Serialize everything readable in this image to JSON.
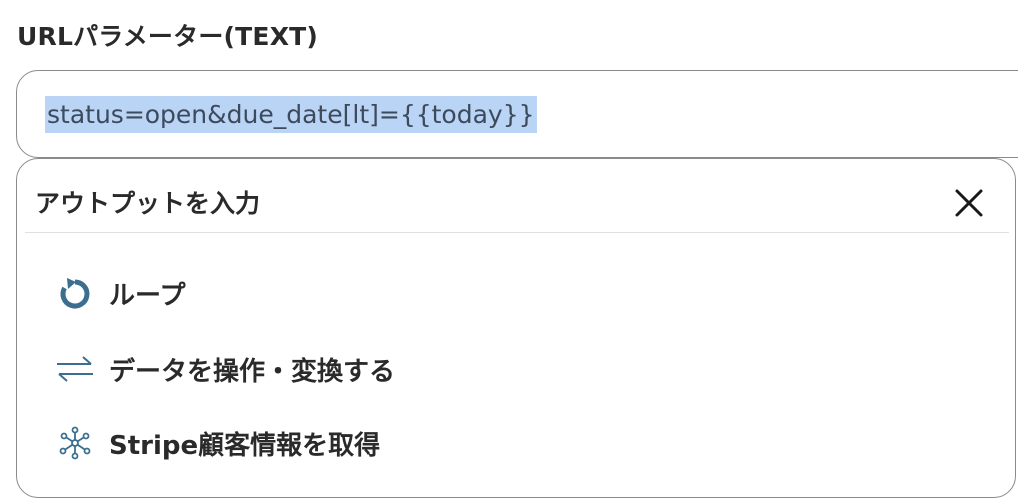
{
  "field": {
    "label": "URLパラメーター(TEXT)",
    "value": "status=open&due_date[lt]={{today}}"
  },
  "output_panel": {
    "title": "アウトプットを入力",
    "items": [
      {
        "label": "ループ",
        "icon": "loop-icon"
      },
      {
        "label": "データを操作・変換する",
        "icon": "transform-arrows-icon"
      },
      {
        "label": "Stripe顧客情報を取得",
        "icon": "network-nodes-icon"
      }
    ]
  },
  "colors": {
    "selection_highlight": "#b9d4f5",
    "icon_blue": "#3b6e8f",
    "border": "#8a8a8a"
  }
}
